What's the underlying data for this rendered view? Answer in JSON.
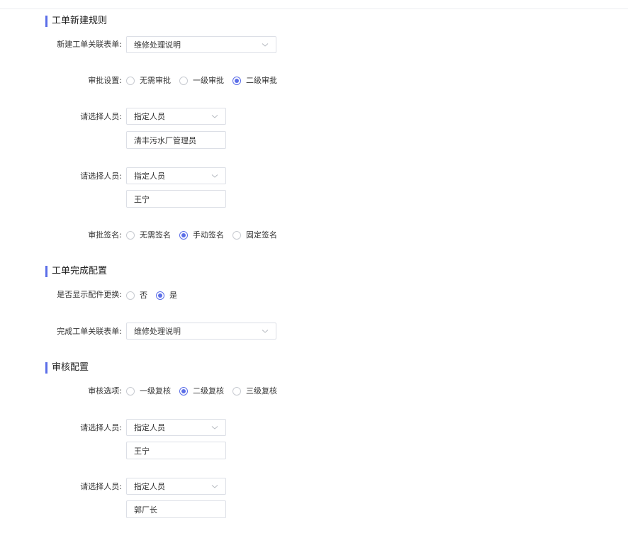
{
  "sections": {
    "new_rules": "工单新建规则",
    "completion": "工单完成配置",
    "review": "审核配置"
  },
  "new_rules": {
    "form_label": "新建工单关联表单:",
    "form_value": "维修处理说明",
    "approval_label": "审批设置:",
    "approval_options": [
      "无需审批",
      "一级审批",
      "二级审批"
    ],
    "approval_selected": "二级审批",
    "approver1_label": "请选择人员:",
    "approver1_type": "指定人员",
    "approver1_value": "清丰污水厂管理员",
    "approver2_label": "请选择人员:",
    "approver2_type": "指定人员",
    "approver2_value": "王宁",
    "signature_label": "审批签名:",
    "signature_options": [
      "无需签名",
      "手动签名",
      "固定签名"
    ],
    "signature_selected": "手动签名"
  },
  "completion": {
    "parts_label": "是否显示配件更换:",
    "parts_options": [
      "否",
      "是"
    ],
    "parts_selected": "是",
    "form_label": "完成工单关联表单:",
    "form_value": "维修处理说明"
  },
  "review": {
    "options_label": "审核选项:",
    "options": [
      "一级复核",
      "二级复核",
      "三级复核"
    ],
    "selected": "二级复核",
    "reviewer1_label": "请选择人员:",
    "reviewer1_type": "指定人员",
    "reviewer1_value": "王宁",
    "reviewer2_label": "请选择人员:",
    "reviewer2_type": "指定人员",
    "reviewer2_value": "郭厂长"
  },
  "colors": {
    "accent": "#5b6ee8",
    "border": "#dcdfe6"
  },
  "icons": {
    "dropdown": "chevron-down-icon"
  }
}
